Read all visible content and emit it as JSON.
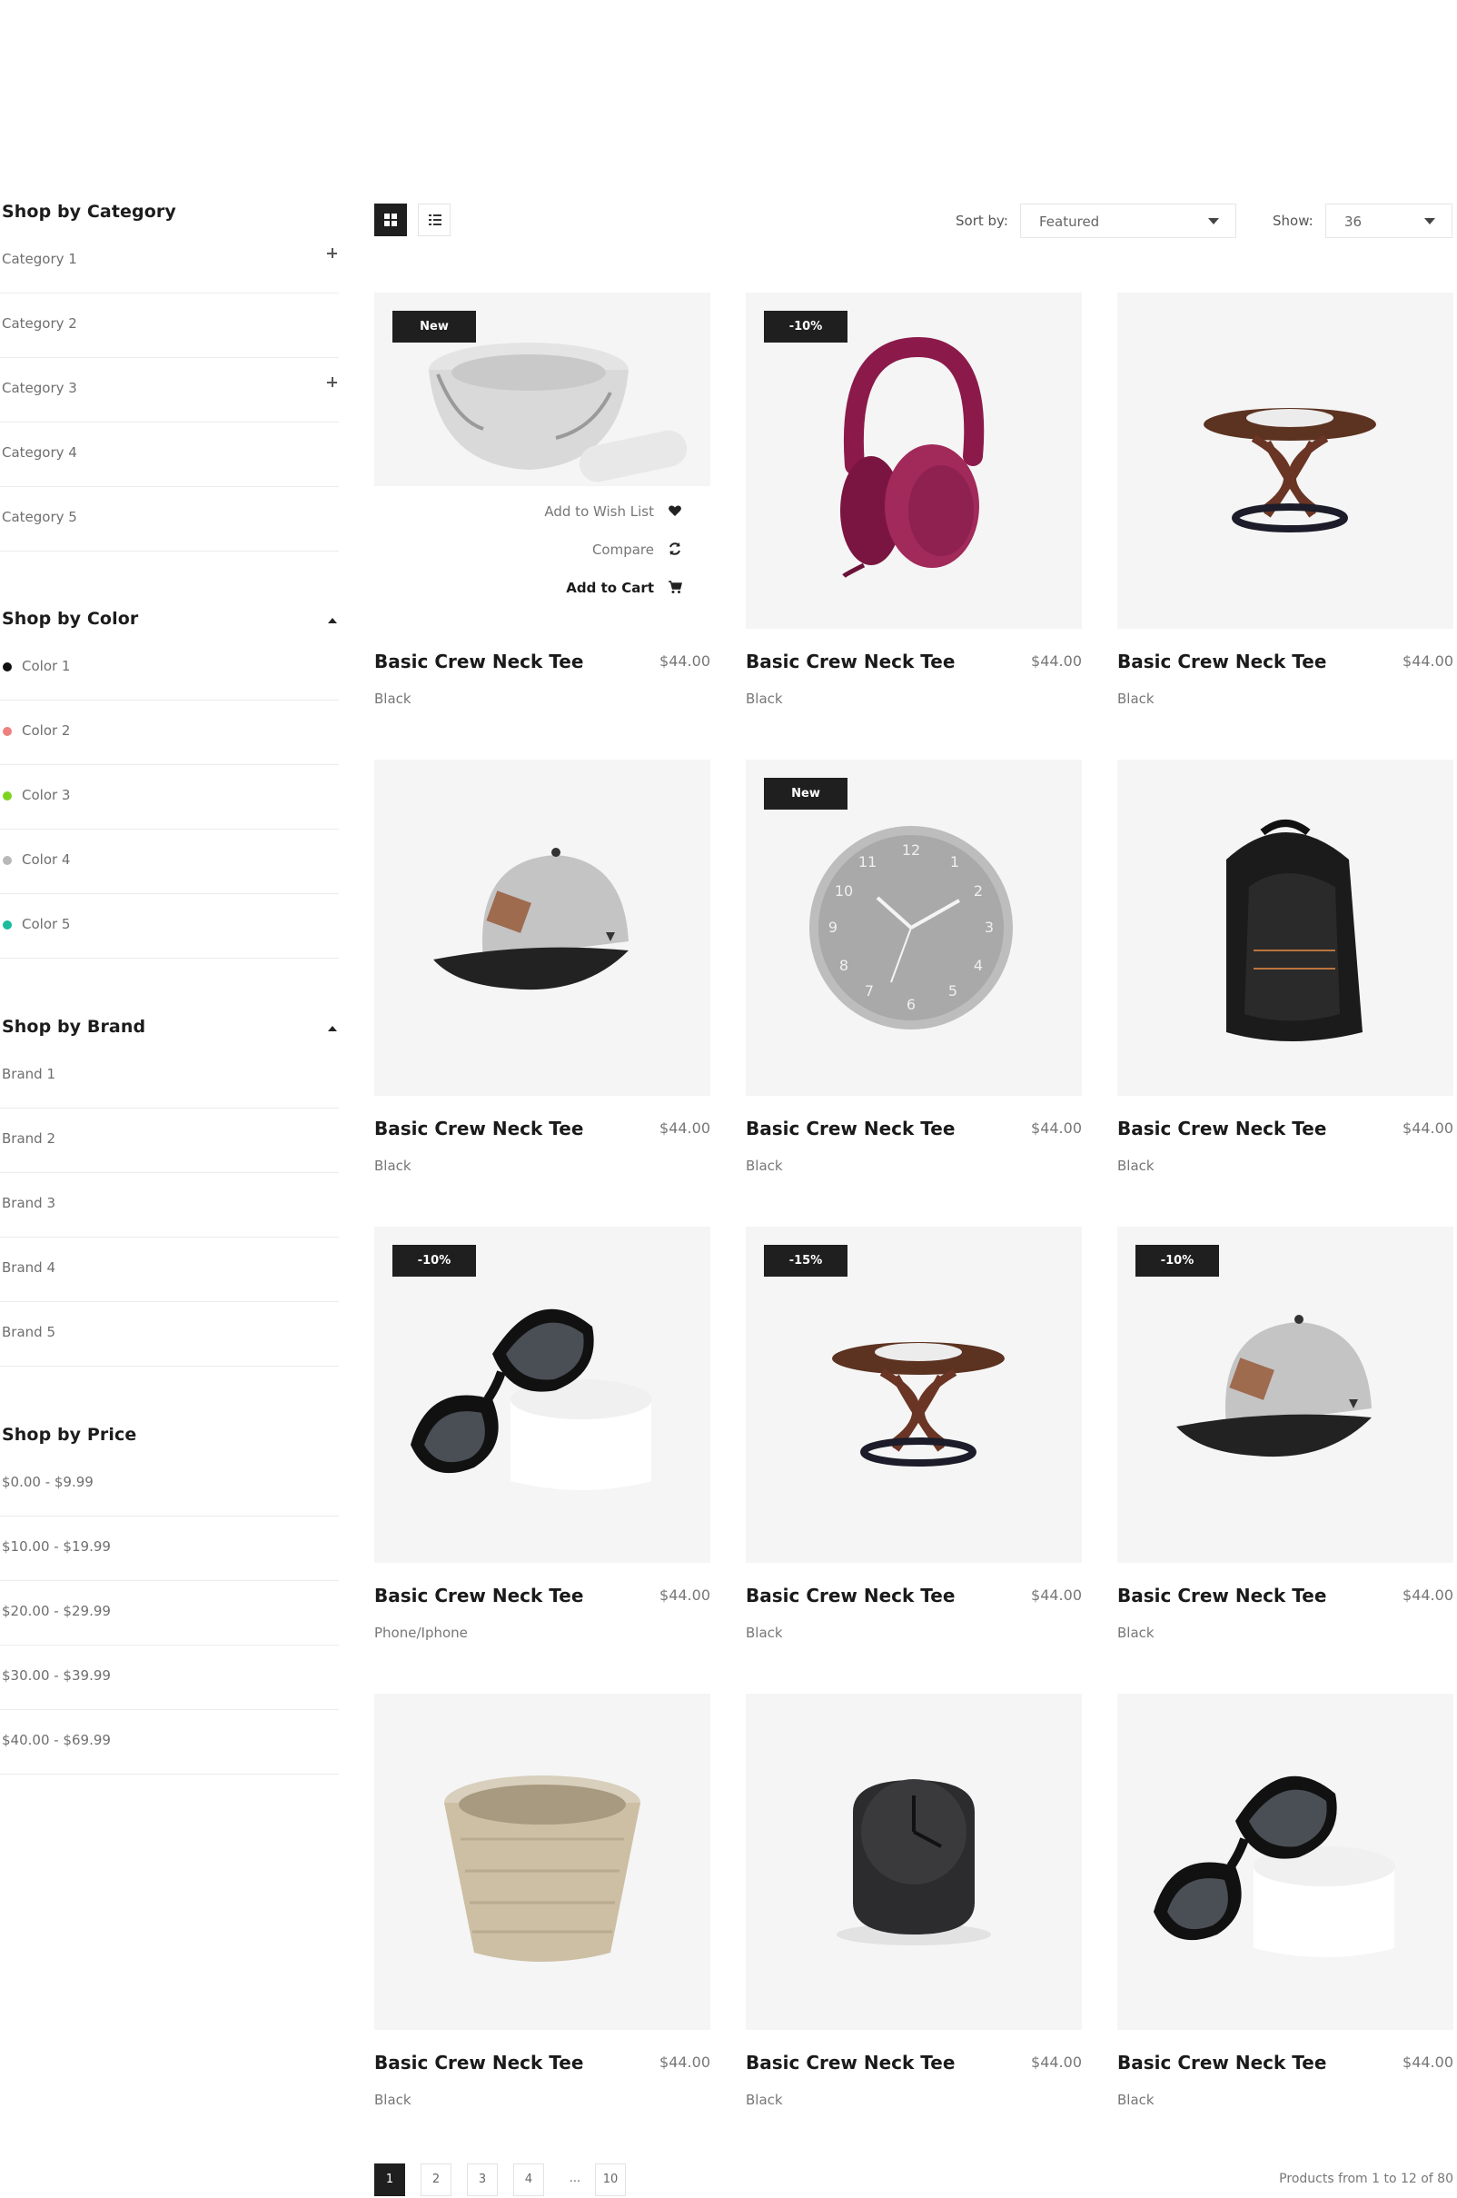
{
  "sidebar": {
    "category": {
      "title": "Shop by Category",
      "items": [
        {
          "label": "Category 1",
          "expandable": true
        },
        {
          "label": "Category 2",
          "expandable": false
        },
        {
          "label": "Category 3",
          "expandable": true
        },
        {
          "label": "Category 4",
          "expandable": false
        },
        {
          "label": "Category 5",
          "expandable": false
        }
      ]
    },
    "color": {
      "title": "Shop by Color",
      "items": [
        {
          "label": "Color 1",
          "swatch": "#111111"
        },
        {
          "label": "Color 2",
          "swatch": "#f08080"
        },
        {
          "label": "Color 3",
          "swatch": "#7ed321"
        },
        {
          "label": "Color 4",
          "swatch": "#b8b8b8"
        },
        {
          "label": "Color 5",
          "swatch": "#1abc9c"
        }
      ]
    },
    "brand": {
      "title": "Shop by Brand",
      "items": [
        "Brand 1",
        "Brand 2",
        "Brand 3",
        "Brand 4",
        "Brand 5"
      ]
    },
    "price": {
      "title": "Shop by Price",
      "items": [
        "$0.00 - $9.99",
        "$10.00 - $19.99",
        "$20.00 - $29.99",
        "$30.00 - $39.99",
        "$40.00 - $69.99"
      ]
    }
  },
  "toolbar": {
    "sort_label": "Sort by:",
    "sort_value": "Featured",
    "show_label": "Show:",
    "show_value": "36"
  },
  "actions": {
    "wishlist": "Add to Wish List",
    "compare": "Compare",
    "cart": "Add to Cart"
  },
  "products": [
    {
      "title": "Basic Crew Neck Tee",
      "price": "$44.00",
      "color": "Black",
      "badge": "New",
      "image": "mortar-pestle"
    },
    {
      "title": "Basic Crew Neck Tee",
      "price": "$44.00",
      "color": "Black",
      "badge": "-10%",
      "image": "headphones"
    },
    {
      "title": "Basic Crew Neck Tee",
      "price": "$44.00",
      "color": "Black",
      "badge": "",
      "image": "side-table"
    },
    {
      "title": "Basic Crew Neck Tee",
      "price": "$44.00",
      "color": "Black",
      "badge": "",
      "image": "cap"
    },
    {
      "title": "Basic Crew Neck Tee",
      "price": "$44.00",
      "color": "Black",
      "badge": "New",
      "image": "wall-clock"
    },
    {
      "title": "Basic Crew Neck Tee",
      "price": "$44.00",
      "color": "Black",
      "badge": "",
      "image": "backpack"
    },
    {
      "title": "Basic Crew Neck Tee",
      "price": "$44.00",
      "color": "Phone/Iphone",
      "badge": "-10%",
      "image": "sunglasses"
    },
    {
      "title": "Basic Crew Neck Tee",
      "price": "$44.00",
      "color": "Black",
      "badge": "-15%",
      "image": "side-table"
    },
    {
      "title": "Basic Crew Neck Tee",
      "price": "$44.00",
      "color": "Black",
      "badge": "-10%",
      "image": "cap"
    },
    {
      "title": "Basic Crew Neck Tee",
      "price": "$44.00",
      "color": "Black",
      "badge": "",
      "image": "basket"
    },
    {
      "title": "Basic Crew Neck Tee",
      "price": "$44.00",
      "color": "Black",
      "badge": "",
      "image": "desk-clock"
    },
    {
      "title": "Basic Crew Neck Tee",
      "price": "$44.00",
      "color": "Black",
      "badge": "",
      "image": "sunglasses"
    }
  ],
  "pagination": {
    "pages": [
      "1",
      "2",
      "3",
      "4",
      "...",
      "10"
    ],
    "active": "1",
    "summary": "Products from 1 to 12 of 80"
  }
}
